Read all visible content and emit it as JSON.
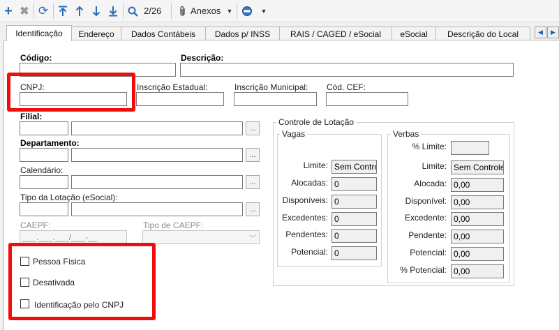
{
  "toolbar": {
    "icons": [
      "plus-icon",
      "close-icon",
      "refresh-icon",
      "first-record-icon",
      "previous-record-icon",
      "next-record-icon",
      "last-record-icon",
      "search-icon",
      "paperclip-icon",
      "no-entry-icon"
    ],
    "record_counter": "2/26",
    "attachments_label": "Anexos"
  },
  "tabs": [
    "Identificação",
    "Endereço",
    "Dados Contábeis",
    "Dados p/ INSS",
    "RAIS / CAGED / eSocial",
    "eSocial",
    "Descrição do Local"
  ],
  "active_tab": "Identificação",
  "form": {
    "codigo": {
      "label": "Código:",
      "value": ""
    },
    "descricao": {
      "label": "Descrição:",
      "value": ""
    },
    "cnpj": {
      "label": "CNPJ:",
      "value": ""
    },
    "inscricao_estadual": {
      "label": "Inscrição Estadual:",
      "value": ""
    },
    "inscricao_municipal": {
      "label": "Inscrição Municipal:",
      "value": ""
    },
    "cod_cef": {
      "label": "Cód. CEF:",
      "value": ""
    },
    "filial": {
      "label": "Filial:"
    },
    "departamento": {
      "label": "Departamento:"
    },
    "calendario": {
      "label": "Calendário:"
    },
    "tipo_lotacao": {
      "label": "Tipo da Lotação (eSocial):"
    },
    "caepf": {
      "label": "CAEPF:",
      "mask": "___.___.___/___-__"
    },
    "tipo_caepf": {
      "label": "Tipo de CAEPF:",
      "value": ""
    },
    "ellipsis": "..."
  },
  "checkboxes": [
    {
      "label": "Pessoa Física",
      "checked": false
    },
    {
      "label": "Desativada",
      "checked": false
    },
    {
      "label": "Identificação pelo CNPJ",
      "checked": false
    }
  ],
  "controle_lotacao": {
    "title": "Controle de Lotação",
    "vagas": {
      "title": "Vagas",
      "rows": [
        {
          "label": "Limite:",
          "value": "Sem Controle"
        },
        {
          "label": "Alocadas:",
          "value": "0"
        },
        {
          "label": "Disponíveis:",
          "value": "0"
        },
        {
          "label": "Excedentes:",
          "value": "0"
        },
        {
          "label": "Pendentes:",
          "value": "0"
        },
        {
          "label": "Potencial:",
          "value": "0"
        }
      ]
    },
    "verbas": {
      "title": "Verbas",
      "rows": [
        {
          "label": "% Limite:",
          "value": ""
        },
        {
          "label": "Limite:",
          "value": "Sem Controle"
        },
        {
          "label": "Alocada:",
          "value": "0,00"
        },
        {
          "label": "Disponível:",
          "value": "0,00"
        },
        {
          "label": "Excedente:",
          "value": "0,00"
        },
        {
          "label": "Pendente:",
          "value": "0,00"
        },
        {
          "label": "Potencial:",
          "value": "0,00"
        },
        {
          "label": "% Potencial:",
          "value": "0,00"
        }
      ]
    }
  },
  "colors": {
    "highlight": "#f20d0d",
    "toolbar_icon": "#2a6db5"
  }
}
